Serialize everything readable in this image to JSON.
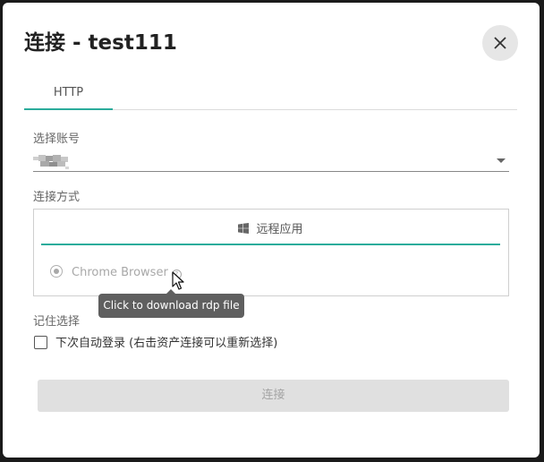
{
  "dialog": {
    "title": "连接 - test111",
    "close_icon": "close-icon"
  },
  "tabs": [
    {
      "label": "HTTP",
      "active": true
    }
  ],
  "account": {
    "label": "选择账号",
    "value_obscured": true
  },
  "connect_method": {
    "label": "连接方式",
    "app_tab_label": "远程应用",
    "app_tab_icon": "windows-icon",
    "option_label": "Chrome Browser",
    "option_selected": true
  },
  "tooltip": {
    "text": "Click to download rdp file"
  },
  "remember": {
    "label": "记住选择",
    "checkbox_label": "下次自动登录 (右击资产连接可以重新选择)",
    "checked": false
  },
  "connect_button": {
    "label": "连接",
    "disabled": true
  },
  "colors": {
    "accent": "#2bac9b",
    "disabled_bg": "#e0e0e0",
    "tooltip_bg": "#5f5f5f"
  }
}
